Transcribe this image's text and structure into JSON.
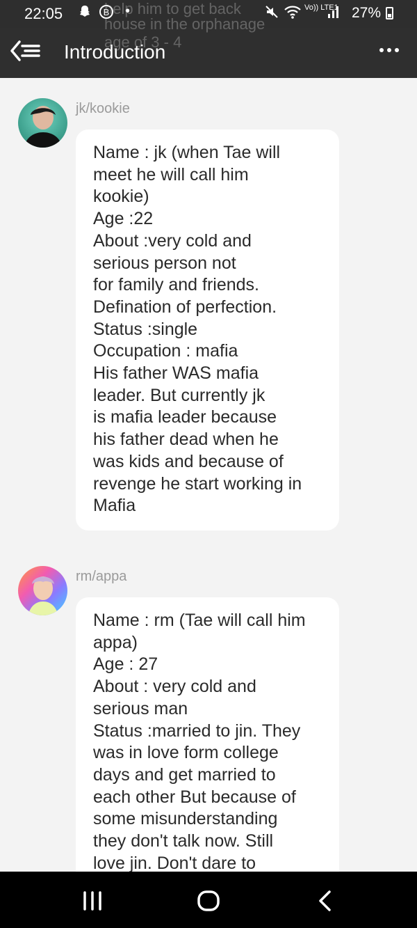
{
  "status": {
    "time": "22:05",
    "battery": "27%",
    "icons": [
      "snapchat-icon",
      "b-circle-icon",
      "dot-icon",
      "mute-icon",
      "wifi-icon",
      "volte-icon",
      "signal-icon",
      "battery-icon"
    ],
    "network": "Vo)) LTE1"
  },
  "overlay": {
    "lines": [
      "help him to get back",
      "house in the orphanage",
      "age of 3 - 4"
    ]
  },
  "appbar": {
    "title": "Introduction",
    "back_icon": "back-menu-icon",
    "more_icon": "more-options-icon"
  },
  "messages": [
    {
      "author": "jk/kookie",
      "lines": [
        "Name : jk (when Tae will",
        "meet he will call him",
        "kookie)",
        "Age :22",
        "About :very cold and",
        "serious person not",
        "for family and friends.",
        "Defination of perfection.",
        "Status :single",
        "Occupation : mafia",
        "His father WAS mafia",
        "leader. But currently jk",
        "is mafia leader because",
        "his father dead when he",
        "was kids and because of",
        "revenge he start working in",
        "Mafia"
      ]
    },
    {
      "author": "rm/appa",
      "lines": [
        "Name : rm (Tae will call him",
        "appa)",
        "Age : 27",
        "About : very cold and",
        "serious man",
        "Status :married to jin. They",
        "was in love form college",
        "days and get married to",
        "each other But because of",
        "some misunderstanding",
        "they don't talk now. Still",
        "love jin. Don't dare to"
      ]
    }
  ],
  "navbar": {
    "icons": [
      "recent-apps-icon",
      "home-icon",
      "back-icon"
    ]
  },
  "colors": {
    "appbar": "#2f2f2f",
    "background": "#f3f3f3",
    "bubble": "#ffffff",
    "author": "#9a9a9a"
  }
}
